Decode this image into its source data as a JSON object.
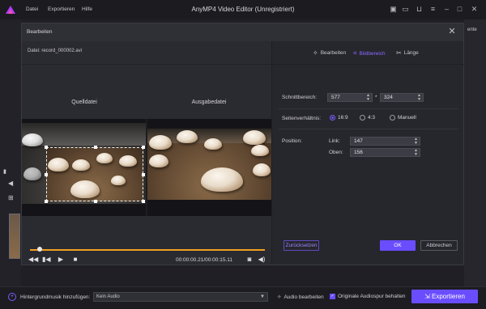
{
  "app": {
    "title": "AnyMP4 Video Editor (Unregistriert)",
    "menu": [
      "Datei",
      "Exportieren",
      "Hilfe"
    ],
    "accent": "#6a4dff",
    "sidepanel_tab": "ente"
  },
  "dialog": {
    "title": "Bearbeiten",
    "file_label": "Datei: record_000002.avi",
    "source_label": "Quelldatei",
    "output_label": "Ausgabedatei",
    "time_code": "00:00:00.21/00:00:15.11",
    "progress_fraction": 0.04,
    "tabs": [
      {
        "label": "Bearbeiten",
        "icon": "magic-wand-icon",
        "active": false
      },
      {
        "label": "Bildbereich",
        "icon": "crop-icon",
        "active": true
      },
      {
        "label": "Länge",
        "icon": "scissors-icon",
        "active": false
      }
    ],
    "crop": {
      "label": "Schnittbereich:",
      "width": "577",
      "height": "324",
      "separator": "*"
    },
    "aspect": {
      "label": "Seitenverhältnis:",
      "options": [
        {
          "label": "16:9",
          "selected": true
        },
        {
          "label": "4:3",
          "selected": false
        },
        {
          "label": "Manuell",
          "selected": false
        }
      ]
    },
    "position": {
      "label": "Position:",
      "left_label": "Link:",
      "left_value": "147",
      "top_label": "Oben:",
      "top_value": "156"
    },
    "buttons": {
      "reset": "Zurücksetzen",
      "ok": "OK",
      "cancel": "Abbrechen"
    }
  },
  "bottom": {
    "bgm_label": "Hintergrundmusik hinzufügen:",
    "audio_value": "Kein Audio",
    "audio_edit": "Audio bearbeiten",
    "keep_audio": "Originale Audiospur behalten",
    "export": "Exportieren"
  }
}
